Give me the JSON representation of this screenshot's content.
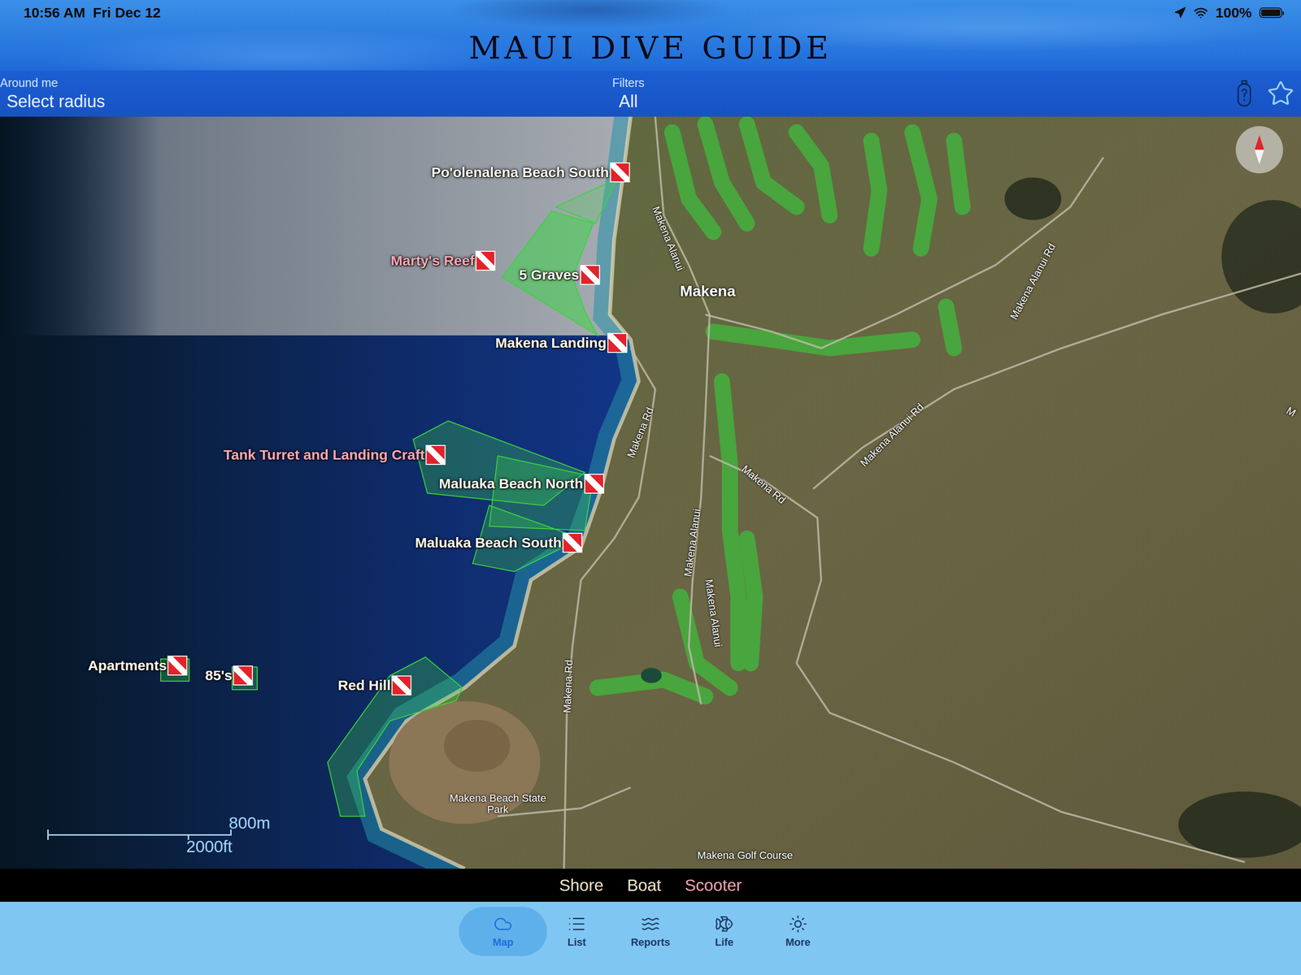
{
  "status_bar": {
    "time": "10:56 AM",
    "date": "Fri Dec 12",
    "battery": "100%",
    "battery_level": 1,
    "location_on": true
  },
  "window": {
    "title": "MAUI DIVE GUIDE"
  },
  "filter_bar": {
    "around_me": {
      "label": "Around me",
      "value": "Select radius"
    },
    "filters": {
      "label": "Filters",
      "value": "All"
    }
  },
  "map": {
    "sites": [
      {
        "name": "Po'olenalena Beach South",
        "color": "#fffaf0"
      },
      {
        "name": "Marty's Reef",
        "color": "#f4a9b8"
      },
      {
        "name": "5 Graves",
        "color": "#fffaf0"
      },
      {
        "name": "Makena Landing",
        "color": "#fffaf0"
      },
      {
        "name": "Tank Turret and Landing Craft",
        "color": "#f4a9b8"
      },
      {
        "name": "Maluaka Beach North",
        "color": "#fffaf0"
      },
      {
        "name": "Maluaka Beach South",
        "color": "#fffaf0"
      },
      {
        "name": "Apartments",
        "color": "#fffaf0"
      },
      {
        "name": "85's",
        "color": "#fffaf0"
      },
      {
        "name": "Red Hill",
        "color": "#fffaf0"
      }
    ],
    "labels": [
      {
        "text": "Makena Alanui",
        "kind": "road"
      },
      {
        "text": "Makena",
        "kind": "town"
      },
      {
        "text": "Makena Alanui Rd",
        "kind": "road"
      },
      {
        "text": "Makena Alanui Rd",
        "kind": "road"
      },
      {
        "text": "Makena Rd",
        "kind": "road"
      },
      {
        "text": "Makena Rd",
        "kind": "road"
      },
      {
        "text": "Makena Alanui",
        "kind": "road"
      },
      {
        "text": "Makena Alanui",
        "kind": "road"
      },
      {
        "text": "Makena Rd",
        "kind": "road"
      },
      {
        "text": "Makena Beach State Park",
        "kind": "park"
      },
      {
        "text": "Makena Golf Course",
        "kind": "park"
      },
      {
        "text": "M",
        "kind": "road"
      }
    ],
    "scale": {
      "metric": "800m",
      "imperial": "2000ft"
    }
  },
  "modes": [
    {
      "label": "Shore",
      "color": "#efe4c8"
    },
    {
      "label": "Boat",
      "color": "#efe4c8"
    },
    {
      "label": "Scooter",
      "color": "#f2a3b2"
    }
  ],
  "tabs": [
    {
      "label": "Map",
      "selected": true
    },
    {
      "label": "List",
      "selected": false
    },
    {
      "label": "Reports",
      "selected": false
    },
    {
      "label": "Life",
      "selected": false
    },
    {
      "label": "More",
      "selected": false
    }
  ]
}
